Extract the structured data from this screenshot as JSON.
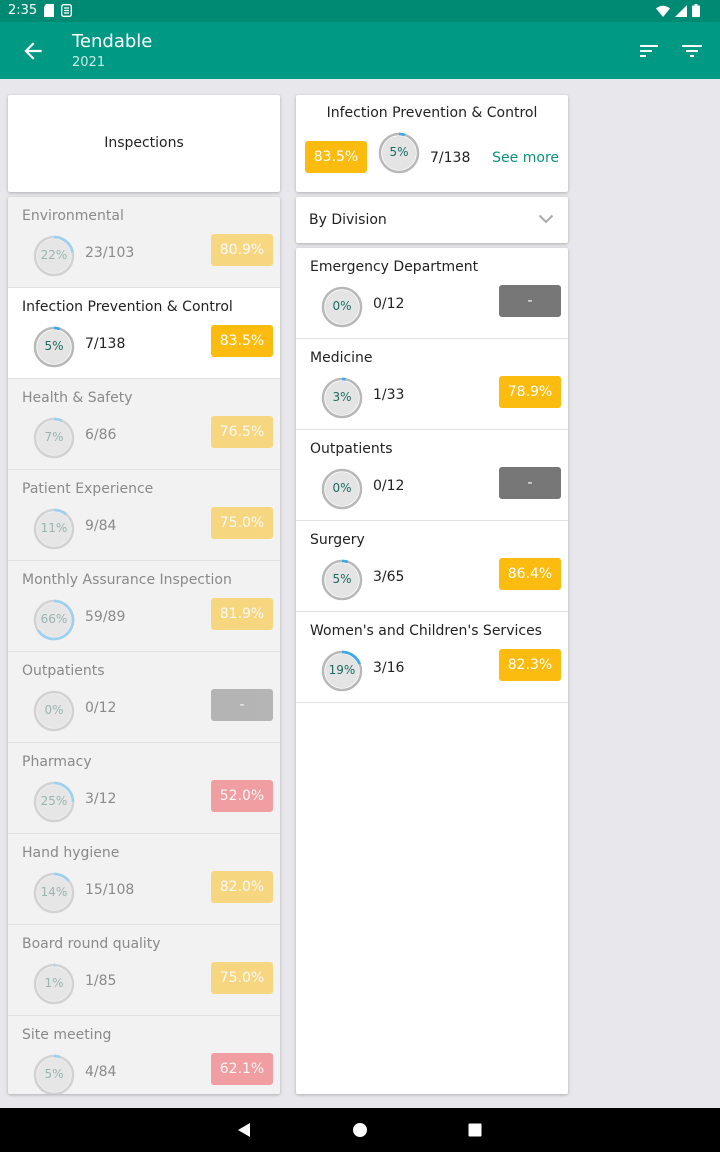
{
  "status_bar": {
    "time": "2:35"
  },
  "app_bar": {
    "title": "Tendable",
    "subtitle": "2021"
  },
  "left_panel": {
    "header_label": "Inspections",
    "items": [
      {
        "name": "Environmental",
        "percent": "22%",
        "count": "23/103",
        "score": "80.9%",
        "color": "#fbbb0f",
        "progress": 0.22,
        "selected": false
      },
      {
        "name": "Infection Prevention & Control",
        "percent": "5%",
        "count": "7/138",
        "score": "83.5%",
        "color": "#fbbb0f",
        "progress": 0.05,
        "selected": true
      },
      {
        "name": "Health & Safety",
        "percent": "7%",
        "count": "6/86",
        "score": "76.5%",
        "color": "#fbbb0f",
        "progress": 0.07,
        "selected": false
      },
      {
        "name": "Patient Experience",
        "percent": "11%",
        "count": "9/84",
        "score": "75.0%",
        "color": "#fbbb0f",
        "progress": 0.11,
        "selected": false
      },
      {
        "name": "Monthly Assurance Inspection",
        "percent": "66%",
        "count": "59/89",
        "score": "81.9%",
        "color": "#fbbb0f",
        "progress": 0.66,
        "selected": false
      },
      {
        "name": "Outpatients",
        "percent": "0%",
        "count": "0/12",
        "score": "-",
        "color": "#777777",
        "progress": 0.0,
        "selected": false
      },
      {
        "name": "Pharmacy",
        "percent": "25%",
        "count": "3/12",
        "score": "52.0%",
        "color": "#ef4d55",
        "progress": 0.25,
        "selected": false
      },
      {
        "name": "Hand hygiene",
        "percent": "14%",
        "count": "15/108",
        "score": "82.0%",
        "color": "#fbbb0f",
        "progress": 0.14,
        "selected": false
      },
      {
        "name": "Board round quality",
        "percent": "1%",
        "count": "1/85",
        "score": "75.0%",
        "color": "#fbbb0f",
        "progress": 0.01,
        "selected": false
      },
      {
        "name": "Site meeting",
        "percent": "5%",
        "count": "4/84",
        "score": "62.1%",
        "color": "#ef4d55",
        "progress": 0.05,
        "selected": false
      }
    ]
  },
  "detail": {
    "title": "Infection Prevention & Control",
    "score": "83.5%",
    "percent": "5%",
    "progress": 0.05,
    "count": "7/138",
    "see_more": "See more"
  },
  "division_select": {
    "label": "By Division"
  },
  "divisions": [
    {
      "name": "Emergency Department",
      "percent": "0%",
      "count": "0/12",
      "score": "-",
      "color": "#777777",
      "progress": 0.0
    },
    {
      "name": "Medicine",
      "percent": "3%",
      "count": "1/33",
      "score": "78.9%",
      "color": "#fbbb0f",
      "progress": 0.03
    },
    {
      "name": "Outpatients",
      "percent": "0%",
      "count": "0/12",
      "score": "-",
      "color": "#777777",
      "progress": 0.0
    },
    {
      "name": "Surgery",
      "percent": "5%",
      "count": "3/65",
      "score": "86.4%",
      "color": "#fbbb0f",
      "progress": 0.05
    },
    {
      "name": "Women's and Children's Services",
      "percent": "19%",
      "count": "3/16",
      "score": "82.3%",
      "color": "#fbbb0f",
      "progress": 0.19
    }
  ],
  "colors": {
    "primary": "#009a84",
    "primary_dark": "#008a74",
    "ring_track": "#b8b8b8",
    "ring_fill": "#3fa9e6",
    "link": "#0c8f7a"
  },
  "icons": [
    "back-arrow-icon",
    "sort-icon",
    "filter-icon",
    "chevron-down-icon",
    "nav-back-icon",
    "nav-home-icon",
    "nav-recents-icon"
  ]
}
